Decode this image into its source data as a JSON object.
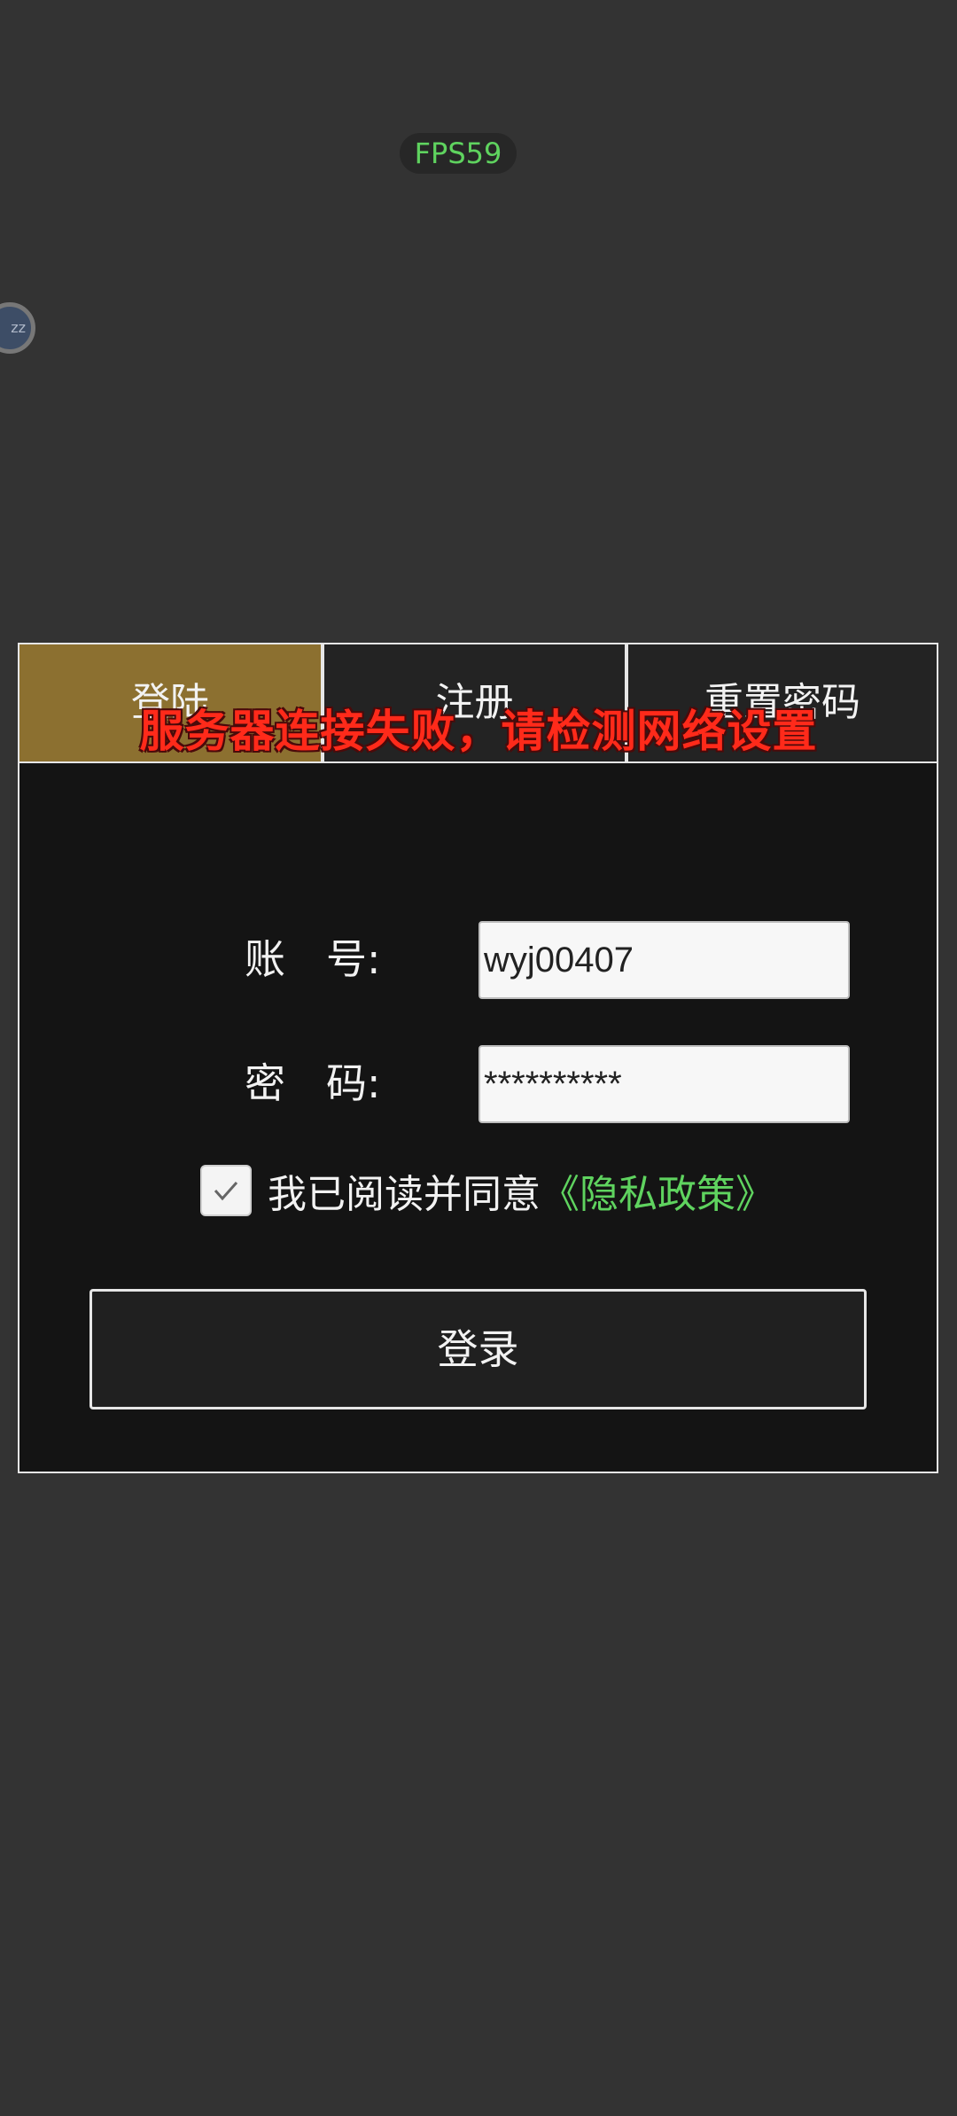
{
  "overlay": {
    "fps": "FPS59",
    "float_ball_text": "zz"
  },
  "tabs": [
    {
      "label": "登陆",
      "active": true
    },
    {
      "label": "注册",
      "active": false
    },
    {
      "label": "重置密码",
      "active": false
    }
  ],
  "toast": {
    "message": "服务器连接失败，请检测网络设置",
    "color": "#ff2a1a"
  },
  "form": {
    "account_label": "账　号:",
    "account_value": "wyj00407",
    "password_label": "密　码:",
    "password_value": "**********",
    "agree_checked": true,
    "agree_text": "我已阅读并同意",
    "privacy_link": "《隐私政策》",
    "login_button": "登录"
  },
  "colors": {
    "background": "#333333",
    "active_tab": "#8c7030",
    "link": "#5fd35f"
  }
}
